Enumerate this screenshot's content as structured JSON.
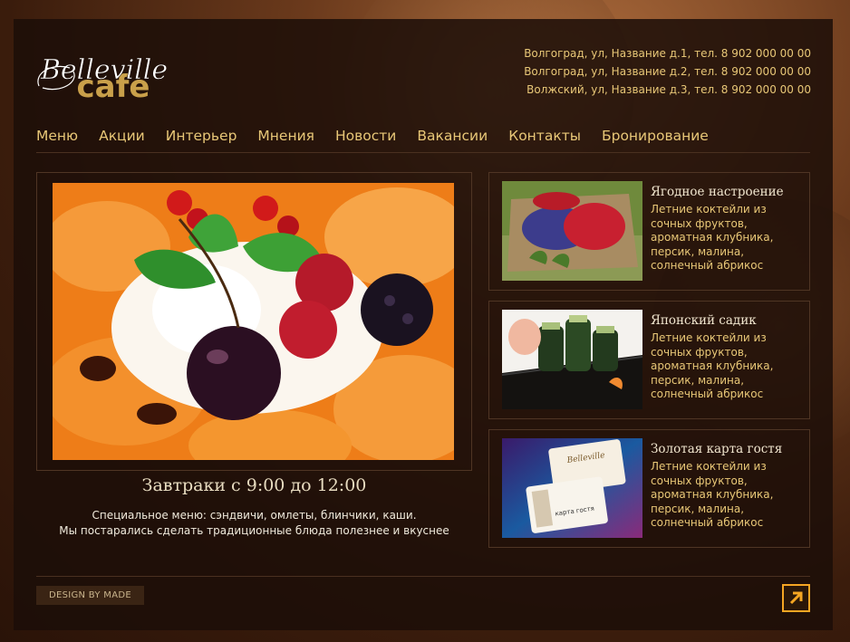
{
  "logo": {
    "script": "Belleville",
    "word": "cafe"
  },
  "addresses": [
    "Волгоград, ул, Название д.1, тел. 8 902 000 00 00",
    "Волгоград, ул, Название д.2, тел. 8 902 000 00 00",
    "Волжский, ул, Название д.3, тел. 8 902 000 00 00"
  ],
  "nav": [
    "Меню",
    "Акции",
    "Интерьер",
    "Мнения",
    "Новости",
    "Вакансии",
    "Контакты",
    "Бронирование"
  ],
  "featured": {
    "title": "Завтраки с 9:00 до 12:00",
    "desc_line1": "Специальное меню: сэндвичи, омлеты, блинчики, каши.",
    "desc_line2": "Мы постарались сделать традиционные блюда полезнее и вкуснее"
  },
  "cards": [
    {
      "title": "Ягодное настроение",
      "text": "Летние коктейли из сочных фруктов, ароматная клубника, персик, малина, солнечный абрикос"
    },
    {
      "title": "Японский садик",
      "text": "Летние коктейли из сочных фруктов, ароматная клубника, персик, малина, солнечный абрикос"
    },
    {
      "title": "Золотая карта гостя",
      "text": "Летние коктейли из сочных фруктов, ароматная клубника, персик, малина, солнечный абрикос"
    }
  ],
  "gift_card": {
    "brand": "Belleville",
    "label": "карта гостя"
  },
  "footer": {
    "design_label": "DESIGN BY MADE"
  },
  "colors": {
    "accent": "#e8c777",
    "orange": "#f5a623",
    "background": "#1c0e08"
  }
}
